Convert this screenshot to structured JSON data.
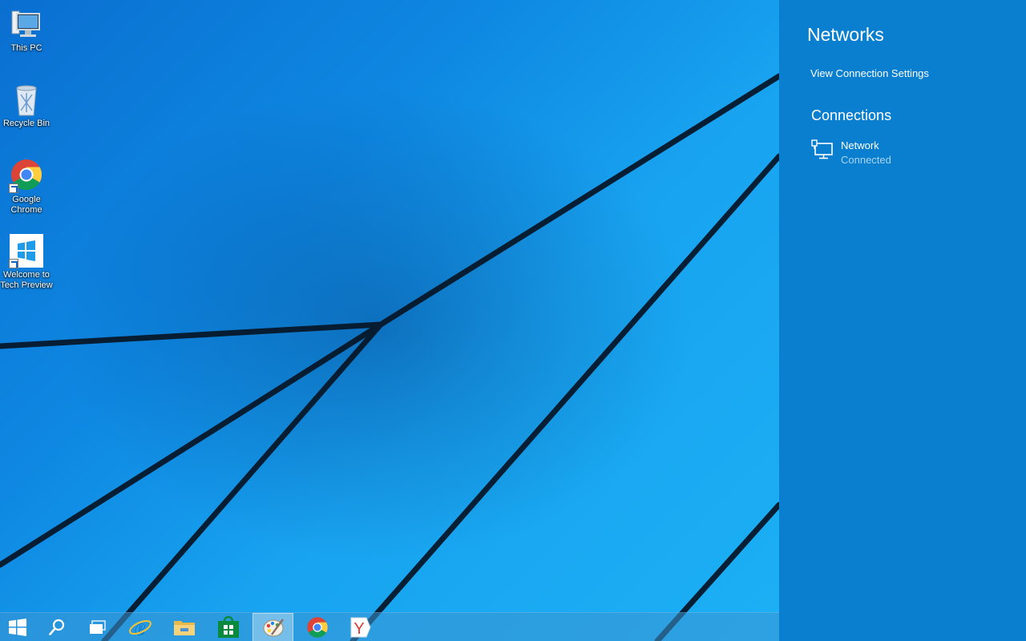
{
  "desktop": {
    "icons": [
      {
        "label": "This PC",
        "icon": "this-pc-icon"
      },
      {
        "label": "Recycle Bin",
        "icon": "recycle-bin-icon"
      },
      {
        "label": "Google\nChrome",
        "icon": "chrome-icon"
      },
      {
        "label": "Welcome to\nTech Preview",
        "icon": "windows-logo-icon"
      }
    ]
  },
  "taskbar": {
    "buttons": [
      {
        "name": "start",
        "icon": "windows-logo-icon"
      },
      {
        "name": "search",
        "icon": "search-icon"
      },
      {
        "name": "task-view",
        "icon": "task-view-icon"
      },
      {
        "name": "internet-explorer",
        "icon": "internet-explorer-icon"
      },
      {
        "name": "file-explorer",
        "icon": "folder-icon"
      },
      {
        "name": "store",
        "icon": "store-icon"
      },
      {
        "name": "paint",
        "icon": "paint-palette-icon",
        "active": true
      },
      {
        "name": "chrome",
        "icon": "chrome-icon"
      },
      {
        "name": "yandex",
        "icon": "yandex-icon",
        "text": "Y"
      }
    ]
  },
  "networks_pane": {
    "title": "Networks",
    "view_settings_link": "View Connection Settings",
    "connections_heading": "Connections",
    "connection": {
      "name": "Network",
      "status": "Connected",
      "icon": "wired-network-icon"
    }
  },
  "colors": {
    "pane_background": "#0a7fcf",
    "wallpaper_blue": "#1a9eee",
    "status_text": "#a9d4f2"
  }
}
